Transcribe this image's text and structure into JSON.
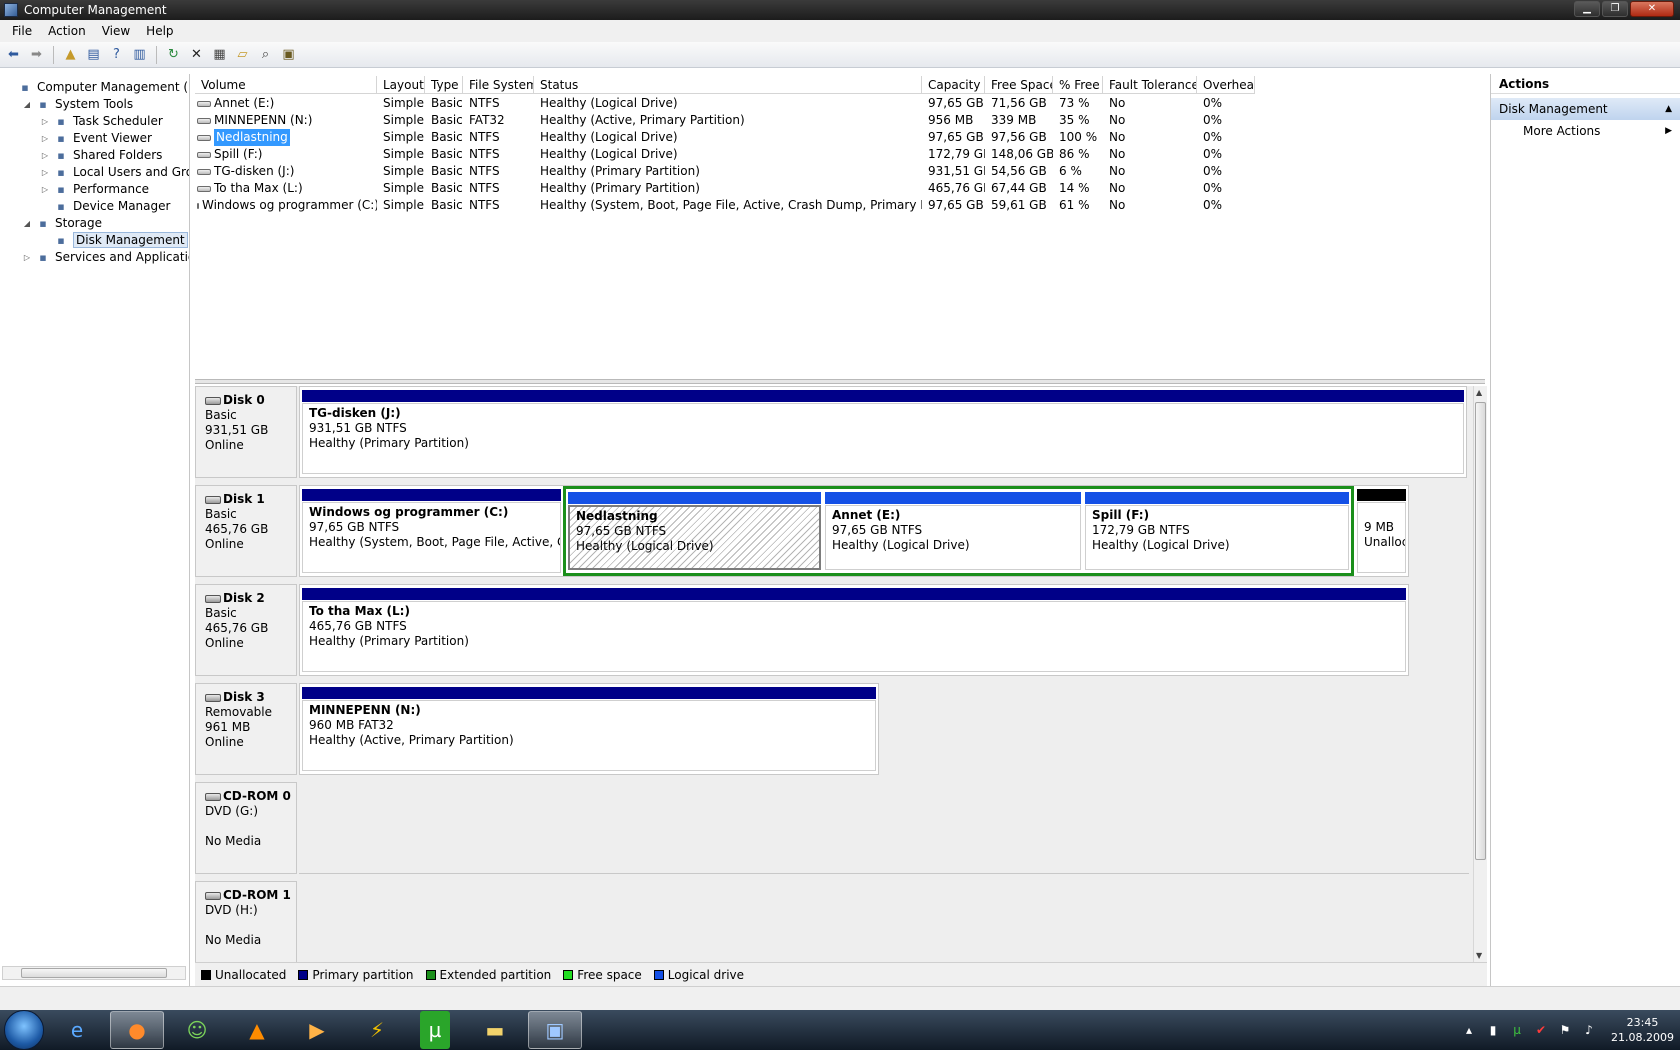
{
  "window": {
    "title": "Computer Management"
  },
  "menu": [
    "File",
    "Action",
    "View",
    "Help"
  ],
  "tree": [
    {
      "label": "Computer Management (Local",
      "depth": 0,
      "expander": "",
      "icon": "computer-icon"
    },
    {
      "label": "System Tools",
      "depth": 1,
      "expander": "◢",
      "icon": "tools-icon"
    },
    {
      "label": "Task Scheduler",
      "depth": 2,
      "expander": "▷",
      "icon": "clock-icon"
    },
    {
      "label": "Event Viewer",
      "depth": 2,
      "expander": "▷",
      "icon": "event-icon"
    },
    {
      "label": "Shared Folders",
      "depth": 2,
      "expander": "▷",
      "icon": "folder-icon"
    },
    {
      "label": "Local Users and Groups",
      "depth": 2,
      "expander": "▷",
      "icon": "users-icon"
    },
    {
      "label": "Performance",
      "depth": 2,
      "expander": "▷",
      "icon": "performance-icon"
    },
    {
      "label": "Device Manager",
      "depth": 2,
      "expander": "",
      "icon": "device-icon"
    },
    {
      "label": "Storage",
      "depth": 1,
      "expander": "◢",
      "icon": "storage-icon"
    },
    {
      "label": "Disk Management",
      "depth": 2,
      "expander": "",
      "icon": "disk-icon",
      "selected": true
    },
    {
      "label": "Services and Applications",
      "depth": 1,
      "expander": "▷",
      "icon": "services-icon"
    }
  ],
  "volumes": {
    "columns": [
      "Volume",
      "Layout",
      "Type",
      "File System",
      "Status",
      "Capacity",
      "Free Space",
      "% Free",
      "Fault Tolerance",
      "Overhead"
    ],
    "rows": [
      [
        "Annet (E:)",
        "Simple",
        "Basic",
        "NTFS",
        "Healthy (Logical Drive)",
        "97,65 GB",
        "71,56 GB",
        "73 %",
        "No",
        "0%"
      ],
      [
        "MINNEPENN (N:)",
        "Simple",
        "Basic",
        "FAT32",
        "Healthy (Active, Primary Partition)",
        "956 MB",
        "339 MB",
        "35 %",
        "No",
        "0%"
      ],
      [
        "Nedlastning",
        "Simple",
        "Basic",
        "NTFS",
        "Healthy (Logical Drive)",
        "97,65 GB",
        "97,56 GB",
        "100 %",
        "No",
        "0%"
      ],
      [
        "Spill (F:)",
        "Simple",
        "Basic",
        "NTFS",
        "Healthy (Logical Drive)",
        "172,79 GB",
        "148,06 GB",
        "86 %",
        "No",
        "0%"
      ],
      [
        "TG-disken (J:)",
        "Simple",
        "Basic",
        "NTFS",
        "Healthy (Primary Partition)",
        "931,51 GB",
        "54,56 GB",
        "6 %",
        "No",
        "0%"
      ],
      [
        "To tha Max (L:)",
        "Simple",
        "Basic",
        "NTFS",
        "Healthy (Primary Partition)",
        "465,76 GB",
        "67,44 GB",
        "14 %",
        "No",
        "0%"
      ],
      [
        "Windows og programmer (C:)",
        "Simple",
        "Basic",
        "NTFS",
        "Healthy (System, Boot, Page File, Active, Crash Dump, Primary Partition)",
        "97,65 GB",
        "59,61 GB",
        "61 %",
        "No",
        "0%"
      ]
    ],
    "selected_index": 2
  },
  "disks": [
    {
      "name": "Disk 0",
      "type": "Basic",
      "size": "931,51 GB",
      "state": "Online",
      "partitions": [
        {
          "name": "TG-disken  (J:)",
          "size": "931,51 GB NTFS",
          "status": "Healthy (Primary Partition)"
        }
      ]
    },
    {
      "name": "Disk 1",
      "type": "Basic",
      "size": "465,76 GB",
      "state": "Online",
      "partitions": [
        {
          "name": "Windows og programmer  (C:)",
          "size": "97,65 GB NTFS",
          "status": "Healthy (System, Boot, Page File, Active, Crash"
        },
        {
          "name": "Nedlastning",
          "size": "97,65 GB NTFS",
          "status": "Healthy (Logical Drive)"
        },
        {
          "name": "Annet  (E:)",
          "size": "97,65 GB NTFS",
          "status": "Healthy (Logical Drive)"
        },
        {
          "name": "Spill  (F:)",
          "size": "172,79 GB NTFS",
          "status": "Healthy (Logical Drive)"
        },
        {
          "name": "",
          "size": "9 MB",
          "status": "Unalloc"
        }
      ]
    },
    {
      "name": "Disk 2",
      "type": "Basic",
      "size": "465,76 GB",
      "state": "Online",
      "partitions": [
        {
          "name": "To tha Max  (L:)",
          "size": "465,76 GB NTFS",
          "status": "Healthy (Primary Partition)"
        }
      ]
    },
    {
      "name": "Disk 3",
      "type": "Removable",
      "size": "961 MB",
      "state": "Online",
      "partitions": [
        {
          "name": "MINNEPENN  (N:)",
          "size": "960 MB FAT32",
          "status": "Healthy (Active, Primary Partition)"
        }
      ]
    },
    {
      "name": "CD-ROM 0",
      "type": "DVD (G:)",
      "size": "",
      "state": "No Media",
      "partitions": []
    },
    {
      "name": "CD-ROM 1",
      "type": "DVD (H:)",
      "size": "",
      "state": "No Media",
      "partitions": []
    }
  ],
  "legend": [
    {
      "label": "Unallocated",
      "color": "#000000"
    },
    {
      "label": "Primary partition",
      "color": "#000088"
    },
    {
      "label": "Extended partition",
      "color": "#1b8f1b"
    },
    {
      "label": "Free space",
      "color": "#22dd22"
    },
    {
      "label": "Logical drive",
      "color": "#1450e6"
    }
  ],
  "actions": {
    "title": "Actions",
    "section": "Disk Management",
    "items": [
      "More Actions"
    ]
  },
  "taskbar": {
    "time": "23:45",
    "date": "21.08.2009"
  }
}
